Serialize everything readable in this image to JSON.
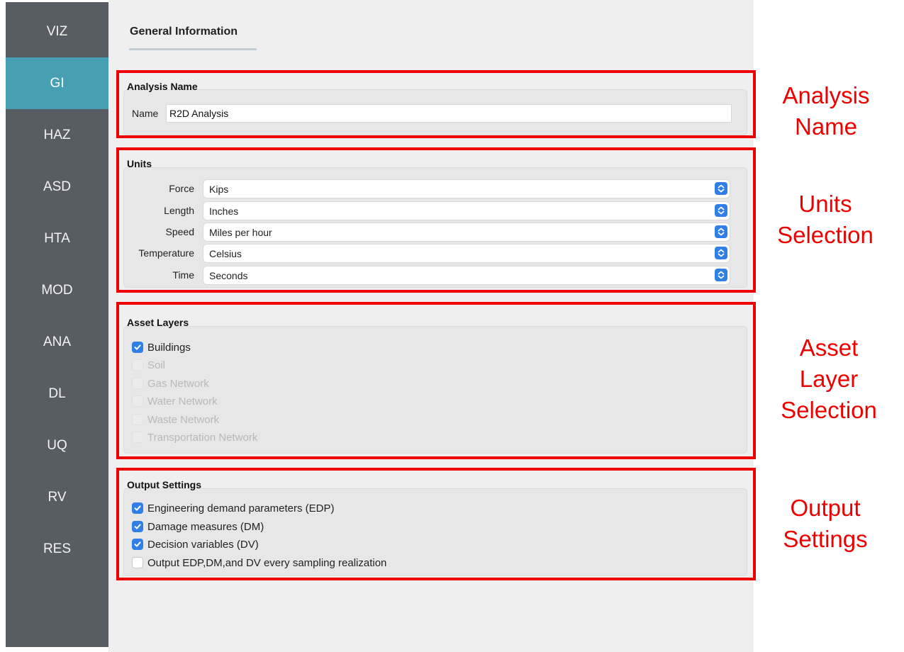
{
  "sidebar": {
    "items": [
      {
        "label": "VIZ",
        "active": false
      },
      {
        "label": "GI",
        "active": true
      },
      {
        "label": "HAZ",
        "active": false
      },
      {
        "label": "ASD",
        "active": false
      },
      {
        "label": "HTA",
        "active": false
      },
      {
        "label": "MOD",
        "active": false
      },
      {
        "label": "ANA",
        "active": false
      },
      {
        "label": "DL",
        "active": false
      },
      {
        "label": "UQ",
        "active": false
      },
      {
        "label": "RV",
        "active": false
      },
      {
        "label": "RES",
        "active": false
      }
    ]
  },
  "tab": {
    "label": "General Information"
  },
  "analysis_name": {
    "title": "Analysis Name",
    "name_label": "Name",
    "name_value": "R2D Analysis"
  },
  "units": {
    "title": "Units",
    "rows": [
      {
        "label": "Force",
        "value": "Kips"
      },
      {
        "label": "Length",
        "value": "Inches"
      },
      {
        "label": "Speed",
        "value": "Miles per hour"
      },
      {
        "label": "Temperature",
        "value": "Celsius"
      },
      {
        "label": "Time",
        "value": "Seconds"
      }
    ]
  },
  "asset_layers": {
    "title": "Asset Layers",
    "items": [
      {
        "label": "Buildings",
        "checked": true,
        "enabled": true
      },
      {
        "label": "Soil",
        "checked": false,
        "enabled": false
      },
      {
        "label": "Gas Network",
        "checked": false,
        "enabled": false
      },
      {
        "label": "Water Network",
        "checked": false,
        "enabled": false
      },
      {
        "label": "Waste Network",
        "checked": false,
        "enabled": false
      },
      {
        "label": "Transportation Network",
        "checked": false,
        "enabled": false
      }
    ]
  },
  "output_settings": {
    "title": "Output Settings",
    "items": [
      {
        "label": "Engineering demand parameters (EDP)",
        "checked": true
      },
      {
        "label": "Damage measures (DM)",
        "checked": true
      },
      {
        "label": "Decision variables (DV)",
        "checked": true
      },
      {
        "label": "Output EDP,DM,and DV every sampling realization",
        "checked": false
      }
    ]
  },
  "annotations": {
    "analysis_name": [
      "Analysis",
      "Name"
    ],
    "units": [
      "Units",
      "Selection"
    ],
    "asset_layers": [
      "Asset",
      "Layer",
      "Selection"
    ],
    "output_settings": [
      "Output",
      "Settings"
    ]
  },
  "colors": {
    "sidebar_bg": "#575d63",
    "active_tab": "#479fb3",
    "annotation_red": "#ee0000",
    "checkbox_blue": "#2f7fe6"
  }
}
